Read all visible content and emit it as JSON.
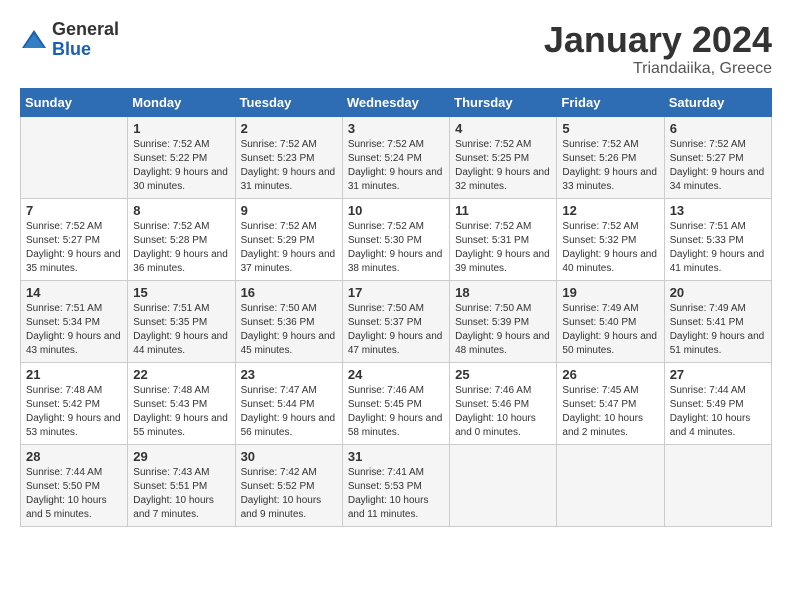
{
  "header": {
    "logo_general": "General",
    "logo_blue": "Blue",
    "month_title": "January 2024",
    "location": "Triandaiika, Greece"
  },
  "days_of_week": [
    "Sunday",
    "Monday",
    "Tuesday",
    "Wednesday",
    "Thursday",
    "Friday",
    "Saturday"
  ],
  "weeks": [
    [
      {
        "day": "",
        "sunrise": "",
        "sunset": "",
        "daylight": ""
      },
      {
        "day": "1",
        "sunrise": "Sunrise: 7:52 AM",
        "sunset": "Sunset: 5:22 PM",
        "daylight": "Daylight: 9 hours and 30 minutes."
      },
      {
        "day": "2",
        "sunrise": "Sunrise: 7:52 AM",
        "sunset": "Sunset: 5:23 PM",
        "daylight": "Daylight: 9 hours and 31 minutes."
      },
      {
        "day": "3",
        "sunrise": "Sunrise: 7:52 AM",
        "sunset": "Sunset: 5:24 PM",
        "daylight": "Daylight: 9 hours and 31 minutes."
      },
      {
        "day": "4",
        "sunrise": "Sunrise: 7:52 AM",
        "sunset": "Sunset: 5:25 PM",
        "daylight": "Daylight: 9 hours and 32 minutes."
      },
      {
        "day": "5",
        "sunrise": "Sunrise: 7:52 AM",
        "sunset": "Sunset: 5:26 PM",
        "daylight": "Daylight: 9 hours and 33 minutes."
      },
      {
        "day": "6",
        "sunrise": "Sunrise: 7:52 AM",
        "sunset": "Sunset: 5:27 PM",
        "daylight": "Daylight: 9 hours and 34 minutes."
      }
    ],
    [
      {
        "day": "7",
        "sunrise": "Sunrise: 7:52 AM",
        "sunset": "Sunset: 5:27 PM",
        "daylight": "Daylight: 9 hours and 35 minutes."
      },
      {
        "day": "8",
        "sunrise": "Sunrise: 7:52 AM",
        "sunset": "Sunset: 5:28 PM",
        "daylight": "Daylight: 9 hours and 36 minutes."
      },
      {
        "day": "9",
        "sunrise": "Sunrise: 7:52 AM",
        "sunset": "Sunset: 5:29 PM",
        "daylight": "Daylight: 9 hours and 37 minutes."
      },
      {
        "day": "10",
        "sunrise": "Sunrise: 7:52 AM",
        "sunset": "Sunset: 5:30 PM",
        "daylight": "Daylight: 9 hours and 38 minutes."
      },
      {
        "day": "11",
        "sunrise": "Sunrise: 7:52 AM",
        "sunset": "Sunset: 5:31 PM",
        "daylight": "Daylight: 9 hours and 39 minutes."
      },
      {
        "day": "12",
        "sunrise": "Sunrise: 7:52 AM",
        "sunset": "Sunset: 5:32 PM",
        "daylight": "Daylight: 9 hours and 40 minutes."
      },
      {
        "day": "13",
        "sunrise": "Sunrise: 7:51 AM",
        "sunset": "Sunset: 5:33 PM",
        "daylight": "Daylight: 9 hours and 41 minutes."
      }
    ],
    [
      {
        "day": "14",
        "sunrise": "Sunrise: 7:51 AM",
        "sunset": "Sunset: 5:34 PM",
        "daylight": "Daylight: 9 hours and 43 minutes."
      },
      {
        "day": "15",
        "sunrise": "Sunrise: 7:51 AM",
        "sunset": "Sunset: 5:35 PM",
        "daylight": "Daylight: 9 hours and 44 minutes."
      },
      {
        "day": "16",
        "sunrise": "Sunrise: 7:50 AM",
        "sunset": "Sunset: 5:36 PM",
        "daylight": "Daylight: 9 hours and 45 minutes."
      },
      {
        "day": "17",
        "sunrise": "Sunrise: 7:50 AM",
        "sunset": "Sunset: 5:37 PM",
        "daylight": "Daylight: 9 hours and 47 minutes."
      },
      {
        "day": "18",
        "sunrise": "Sunrise: 7:50 AM",
        "sunset": "Sunset: 5:39 PM",
        "daylight": "Daylight: 9 hours and 48 minutes."
      },
      {
        "day": "19",
        "sunrise": "Sunrise: 7:49 AM",
        "sunset": "Sunset: 5:40 PM",
        "daylight": "Daylight: 9 hours and 50 minutes."
      },
      {
        "day": "20",
        "sunrise": "Sunrise: 7:49 AM",
        "sunset": "Sunset: 5:41 PM",
        "daylight": "Daylight: 9 hours and 51 minutes."
      }
    ],
    [
      {
        "day": "21",
        "sunrise": "Sunrise: 7:48 AM",
        "sunset": "Sunset: 5:42 PM",
        "daylight": "Daylight: 9 hours and 53 minutes."
      },
      {
        "day": "22",
        "sunrise": "Sunrise: 7:48 AM",
        "sunset": "Sunset: 5:43 PM",
        "daylight": "Daylight: 9 hours and 55 minutes."
      },
      {
        "day": "23",
        "sunrise": "Sunrise: 7:47 AM",
        "sunset": "Sunset: 5:44 PM",
        "daylight": "Daylight: 9 hours and 56 minutes."
      },
      {
        "day": "24",
        "sunrise": "Sunrise: 7:46 AM",
        "sunset": "Sunset: 5:45 PM",
        "daylight": "Daylight: 9 hours and 58 minutes."
      },
      {
        "day": "25",
        "sunrise": "Sunrise: 7:46 AM",
        "sunset": "Sunset: 5:46 PM",
        "daylight": "Daylight: 10 hours and 0 minutes."
      },
      {
        "day": "26",
        "sunrise": "Sunrise: 7:45 AM",
        "sunset": "Sunset: 5:47 PM",
        "daylight": "Daylight: 10 hours and 2 minutes."
      },
      {
        "day": "27",
        "sunrise": "Sunrise: 7:44 AM",
        "sunset": "Sunset: 5:49 PM",
        "daylight": "Daylight: 10 hours and 4 minutes."
      }
    ],
    [
      {
        "day": "28",
        "sunrise": "Sunrise: 7:44 AM",
        "sunset": "Sunset: 5:50 PM",
        "daylight": "Daylight: 10 hours and 5 minutes."
      },
      {
        "day": "29",
        "sunrise": "Sunrise: 7:43 AM",
        "sunset": "Sunset: 5:51 PM",
        "daylight": "Daylight: 10 hours and 7 minutes."
      },
      {
        "day": "30",
        "sunrise": "Sunrise: 7:42 AM",
        "sunset": "Sunset: 5:52 PM",
        "daylight": "Daylight: 10 hours and 9 minutes."
      },
      {
        "day": "31",
        "sunrise": "Sunrise: 7:41 AM",
        "sunset": "Sunset: 5:53 PM",
        "daylight": "Daylight: 10 hours and 11 minutes."
      },
      {
        "day": "",
        "sunrise": "",
        "sunset": "",
        "daylight": ""
      },
      {
        "day": "",
        "sunrise": "",
        "sunset": "",
        "daylight": ""
      },
      {
        "day": "",
        "sunrise": "",
        "sunset": "",
        "daylight": ""
      }
    ]
  ]
}
